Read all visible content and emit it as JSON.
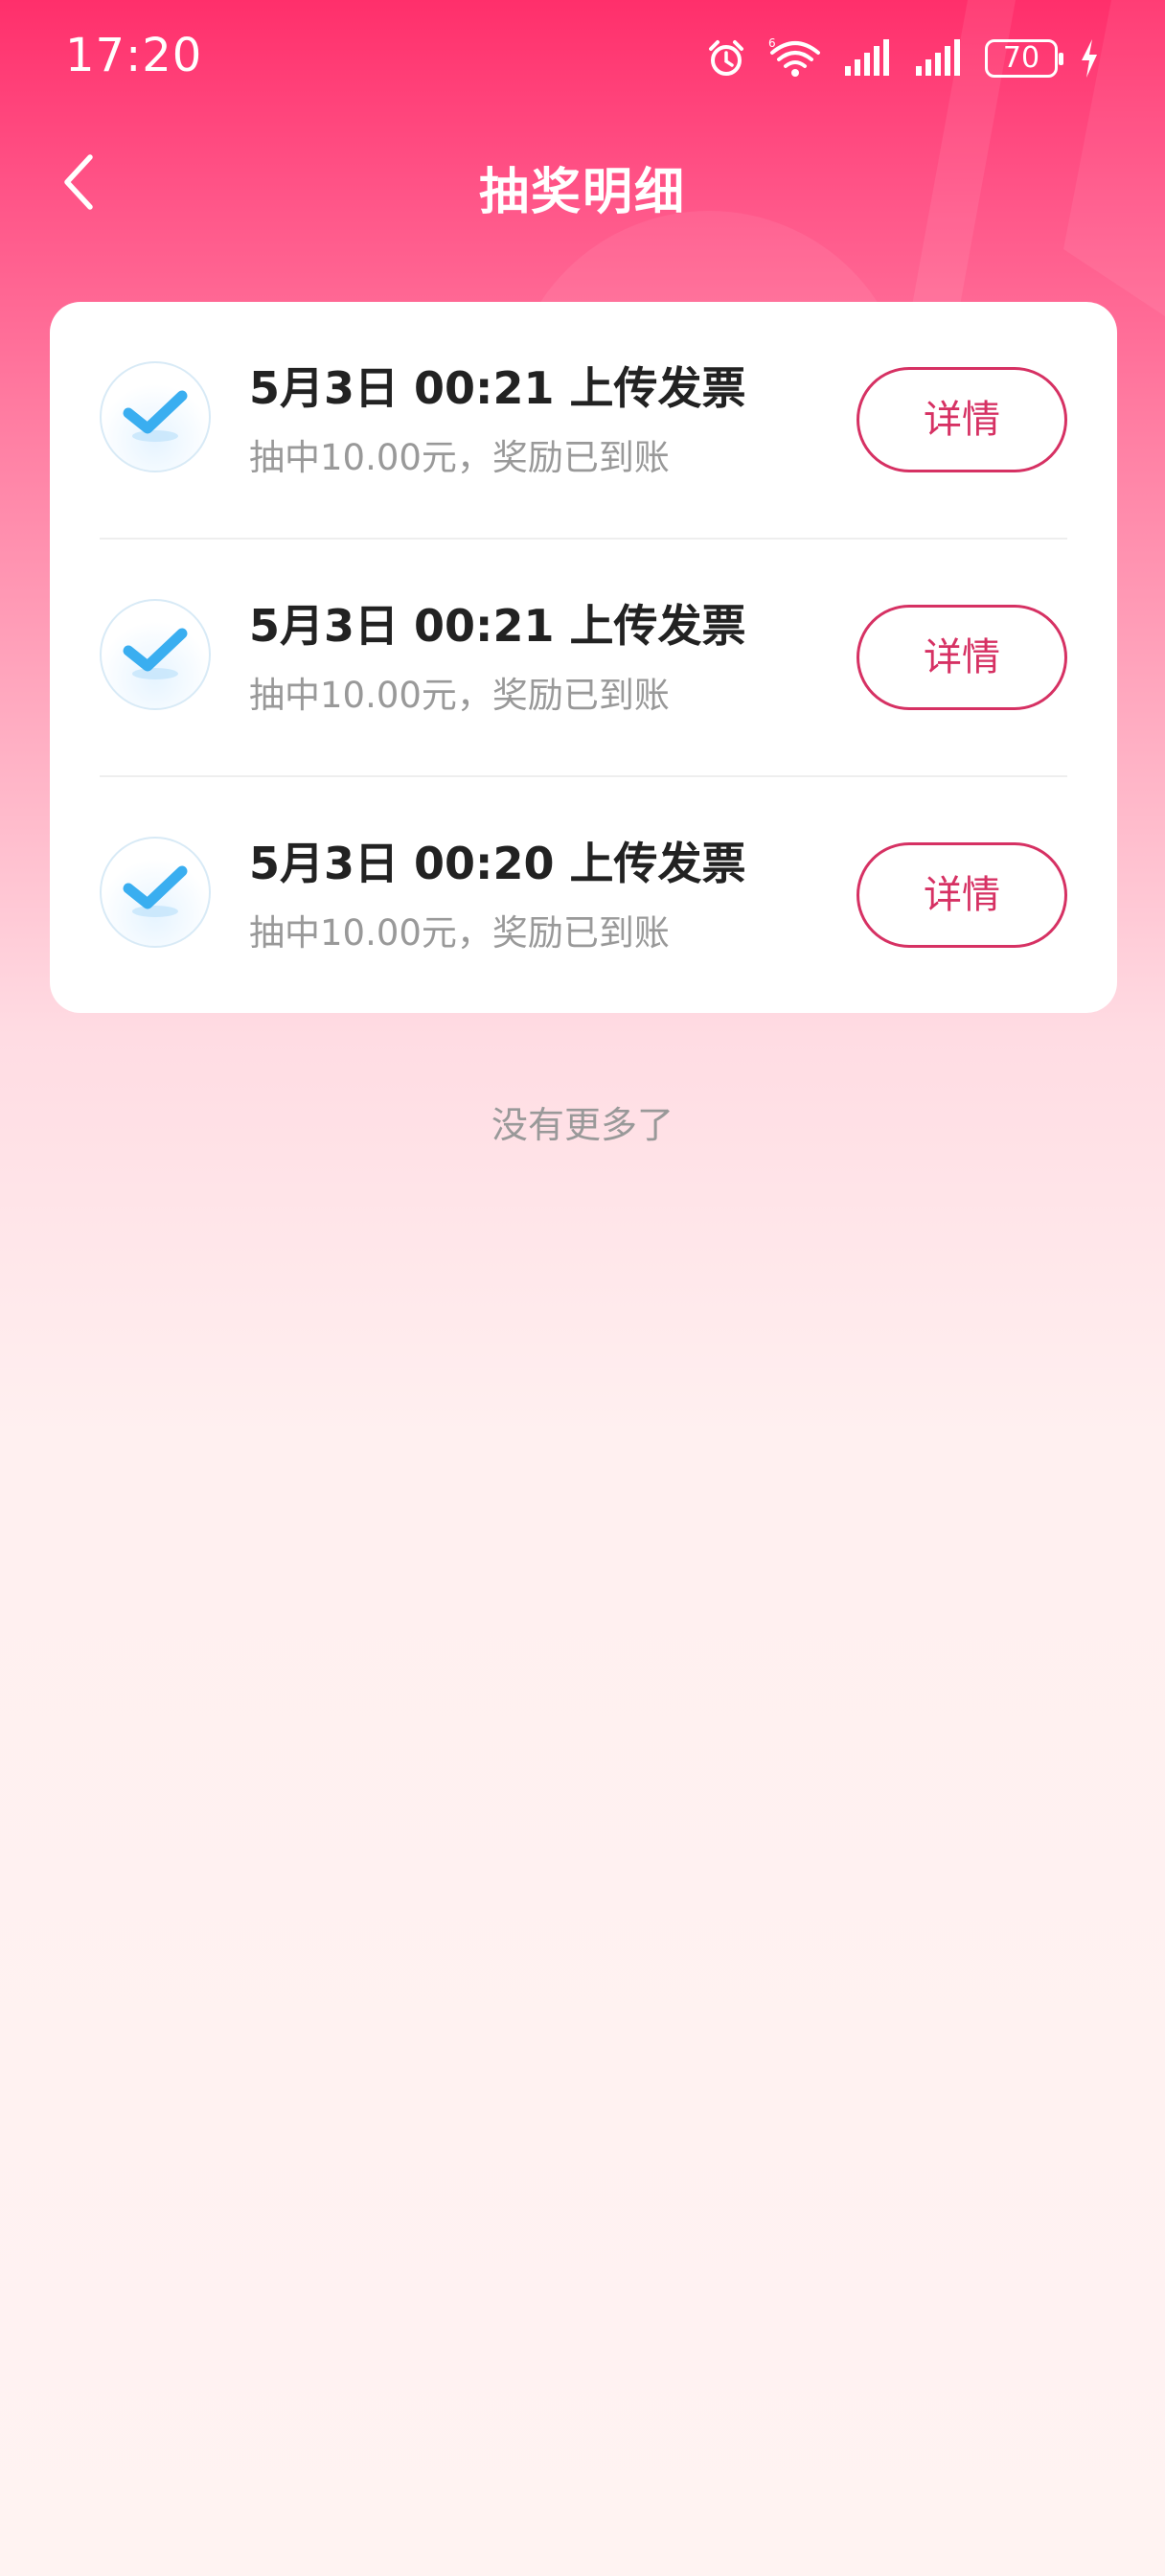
{
  "status_bar": {
    "time": "17:20",
    "battery": "70",
    "icons": [
      "alarm-icon",
      "wifi-icon",
      "signal-icon",
      "signal-icon",
      "battery-icon",
      "charging-icon"
    ]
  },
  "header": {
    "title": "抽奖明细",
    "back_icon": "back-arrow-icon"
  },
  "records": [
    {
      "title": "5月3日 00:21 上传发票",
      "subtitle": "抽中10.00元，奖励已到账",
      "button": "详情",
      "icon": "check-icon"
    },
    {
      "title": "5月3日 00:21 上传发票",
      "subtitle": "抽中10.00元，奖励已到账",
      "button": "详情",
      "icon": "check-icon"
    },
    {
      "title": "5月3日 00:20 上传发票",
      "subtitle": "抽中10.00元，奖励已到账",
      "button": "详情",
      "icon": "check-icon"
    }
  ],
  "footer": {
    "no_more_text": "没有更多了"
  },
  "colors": {
    "accent": "#d63163",
    "header_gradient_top": "#ff2f6b",
    "background_bottom": "#fff3f2",
    "check_blue": "#3aaef0"
  }
}
